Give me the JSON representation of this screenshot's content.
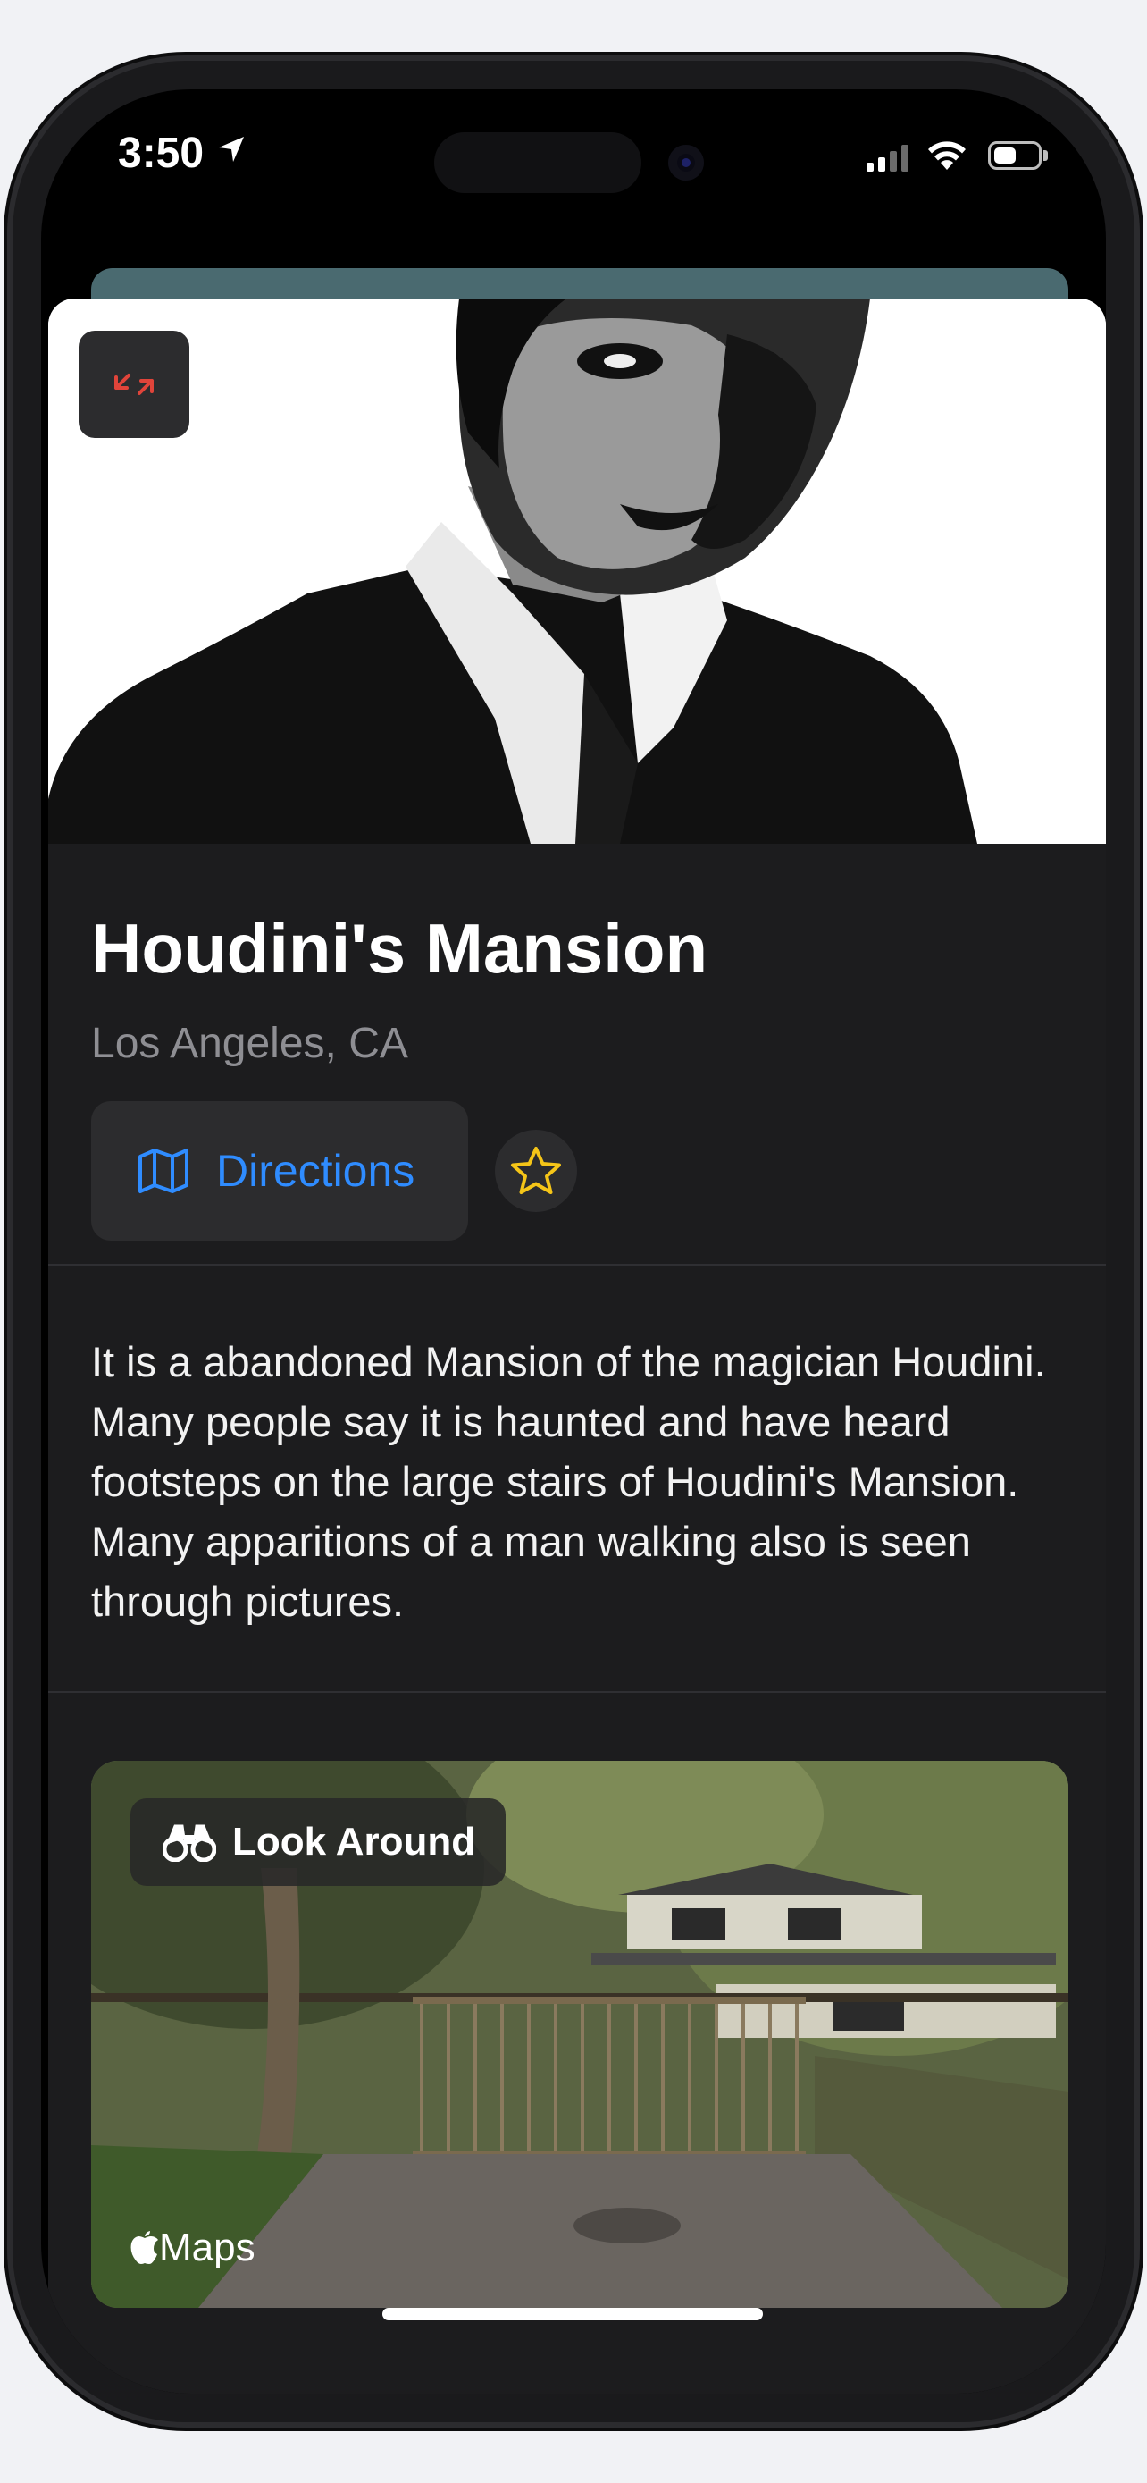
{
  "status_bar": {
    "time": "3:50"
  },
  "place": {
    "title": "Houdini's Mansion",
    "location": "Los Angeles, CA",
    "description": "It is a abandoned Mansion of the magician Houdini. Many people say it is haunted and have heard footsteps on the large stairs of Houdini's Mansion. Many apparitions of a man walking also is seen through pictures."
  },
  "actions": {
    "directions_label": "Directions",
    "favorite_icon": "star-icon"
  },
  "look_around": {
    "label": "Look Around",
    "maps_label": "Maps"
  },
  "colors": {
    "accent_blue": "#2f8cff",
    "star_yellow": "#f5c518",
    "collapse_red": "#e0443a",
    "sheet_bg": "#1c1c1e"
  }
}
